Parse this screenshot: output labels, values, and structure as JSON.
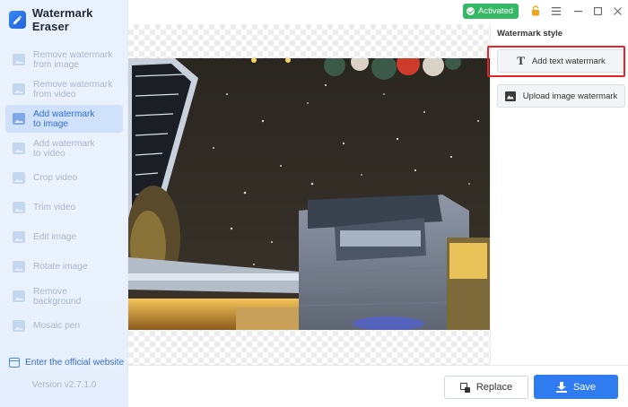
{
  "app": {
    "name": "Watermark Eraser",
    "version": "Version v2.7.1.0",
    "activation_status": "Activated",
    "accent_color": "#2e7cf0"
  },
  "sidebar": {
    "items": [
      {
        "label_line1": "Remove watermark",
        "label_line2": "from image",
        "icon": "image-icon",
        "active": false
      },
      {
        "label_line1": "Remove watermark",
        "label_line2": "from video",
        "icon": "video-icon",
        "active": false
      },
      {
        "label_line1": "Add watermark",
        "label_line2": "to image",
        "icon": "image-icon",
        "active": true
      },
      {
        "label_line1": "Add watermark",
        "label_line2": "to video",
        "icon": "video-icon",
        "active": false
      },
      {
        "label_line1": "Crop video",
        "label_line2": "",
        "icon": "crop-icon",
        "active": false
      },
      {
        "label_line1": "Trim video",
        "label_line2": "",
        "icon": "trim-icon",
        "active": false
      },
      {
        "label_line1": "Edit image",
        "label_line2": "",
        "icon": "edit-image-icon",
        "active": false
      },
      {
        "label_line1": "Rotate image",
        "label_line2": "",
        "icon": "rotate-icon",
        "active": false
      },
      {
        "label_line1": "Remove background",
        "label_line2": "",
        "icon": "remove-bg-icon",
        "active": false
      },
      {
        "label_line1": "Mosaic pen",
        "label_line2": "",
        "icon": "mosaic-icon",
        "active": false
      }
    ],
    "official_website": "Enter the official website"
  },
  "panel": {
    "title": "Watermark style",
    "add_text_watermark": "Add text watermark",
    "upload_image_watermark": "Upload image watermark"
  },
  "bottom": {
    "replace_label": "Replace",
    "save_label": "Save"
  }
}
